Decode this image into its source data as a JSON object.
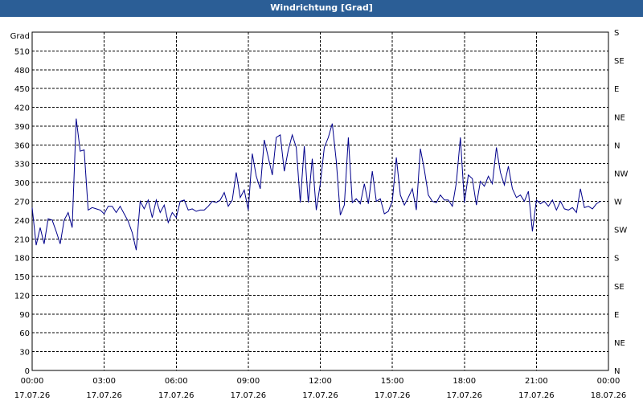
{
  "window": {
    "title": "Windrichtung [Grad]"
  },
  "colors": {
    "titlebar": "#2b5e96",
    "series": "#00008b",
    "grid": "#000000",
    "background": "#ffffff"
  },
  "chart_data": {
    "type": "line",
    "title": "Windrichtung [Grad]",
    "ylabel": "Grad",
    "xlabel": "",
    "ylim": [
      0,
      540
    ],
    "xlim": [
      "17.07.26 00:00",
      "18.07.26 00:00"
    ],
    "grid": true,
    "y_ticks": [
      0,
      30,
      60,
      90,
      120,
      150,
      180,
      210,
      240,
      270,
      300,
      330,
      360,
      390,
      420,
      450,
      480,
      510
    ],
    "x_ticks": [
      {
        "time": "00:00",
        "date": "17.07.26"
      },
      {
        "time": "03:00",
        "date": "17.07.26"
      },
      {
        "time": "06:00",
        "date": "17.07.26"
      },
      {
        "time": "09:00",
        "date": "17.07.26"
      },
      {
        "time": "12:00",
        "date": "17.07.26"
      },
      {
        "time": "15:00",
        "date": "17.07.26"
      },
      {
        "time": "18:00",
        "date": "17.07.26"
      },
      {
        "time": "21:00",
        "date": "17.07.26"
      },
      {
        "time": "00:00",
        "date": "18.07.26"
      }
    ],
    "right_axis": [
      {
        "label": "N",
        "value": 0
      },
      {
        "label": "NE",
        "value": 45
      },
      {
        "label": "E",
        "value": 90
      },
      {
        "label": "SE",
        "value": 135
      },
      {
        "label": "S",
        "value": 180
      },
      {
        "label": "SW",
        "value": 225
      },
      {
        "label": "W",
        "value": 270
      },
      {
        "label": "NW",
        "value": 315
      },
      {
        "label": "N",
        "value": 360
      },
      {
        "label": "NE",
        "value": 405
      },
      {
        "label": "E",
        "value": 450
      },
      {
        "label": "SE",
        "value": 495
      },
      {
        "label": "S",
        "value": 540
      }
    ],
    "series": [
      {
        "values": [
          [
            "17.07.26 00:00",
            260
          ],
          [
            "17.07.26 00:10",
            200
          ],
          [
            "17.07.26 00:20",
            228
          ],
          [
            "17.07.26 00:30",
            202
          ],
          [
            "17.07.26 00:40",
            242
          ],
          [
            "17.07.26 00:50",
            240
          ],
          [
            "17.07.26 01:00",
            222
          ],
          [
            "17.07.26 01:10",
            202
          ],
          [
            "17.07.26 01:20",
            240
          ],
          [
            "17.07.26 01:30",
            252
          ],
          [
            "17.07.26 01:40",
            228
          ],
          [
            "17.07.26 01:50",
            402
          ],
          [
            "17.07.26 02:00",
            350
          ],
          [
            "17.07.26 02:10",
            352
          ],
          [
            "17.07.26 02:20",
            256
          ],
          [
            "17.07.26 02:30",
            260
          ],
          [
            "17.07.26 02:40",
            258
          ],
          [
            "17.07.26 02:50",
            256
          ],
          [
            "17.07.26 03:00",
            250
          ],
          [
            "17.07.26 03:10",
            262
          ],
          [
            "17.07.26 03:20",
            262
          ],
          [
            "17.07.26 03:30",
            252
          ],
          [
            "17.07.26 03:40",
            262
          ],
          [
            "17.07.26 03:50",
            250
          ],
          [
            "17.07.26 04:00",
            238
          ],
          [
            "17.07.26 04:10",
            220
          ],
          [
            "17.07.26 04:20",
            192
          ],
          [
            "17.07.26 04:30",
            270
          ],
          [
            "17.07.26 04:40",
            258
          ],
          [
            "17.07.26 04:50",
            272
          ],
          [
            "17.07.26 05:00",
            244
          ],
          [
            "17.07.26 05:10",
            272
          ],
          [
            "17.07.26 05:20",
            252
          ],
          [
            "17.07.26 05:30",
            264
          ],
          [
            "17.07.26 05:40",
            236
          ],
          [
            "17.07.26 05:50",
            252
          ],
          [
            "17.07.26 06:00",
            244
          ],
          [
            "17.07.26 06:10",
            270
          ],
          [
            "17.07.26 06:20",
            272
          ],
          [
            "17.07.26 06:30",
            256
          ],
          [
            "17.07.26 06:40",
            258
          ],
          [
            "17.07.26 06:50",
            254
          ],
          [
            "17.07.26 07:00",
            256
          ],
          [
            "17.07.26 07:10",
            256
          ],
          [
            "17.07.26 07:20",
            262
          ],
          [
            "17.07.26 07:30",
            270
          ],
          [
            "17.07.26 07:40",
            268
          ],
          [
            "17.07.26 07:50",
            272
          ],
          [
            "17.07.26 08:00",
            284
          ],
          [
            "17.07.26 08:10",
            262
          ],
          [
            "17.07.26 08:20",
            272
          ],
          [
            "17.07.26 08:30",
            316
          ],
          [
            "17.07.26 08:40",
            276
          ],
          [
            "17.07.26 08:50",
            288
          ],
          [
            "17.07.26 09:00",
            256
          ],
          [
            "17.07.26 09:10",
            346
          ],
          [
            "17.07.26 09:20",
            310
          ],
          [
            "17.07.26 09:30",
            290
          ],
          [
            "17.07.26 09:40",
            368
          ],
          [
            "17.07.26 09:50",
            340
          ],
          [
            "17.07.26 10:00",
            312
          ],
          [
            "17.07.26 10:10",
            372
          ],
          [
            "17.07.26 10:20",
            376
          ],
          [
            "17.07.26 10:30",
            318
          ],
          [
            "17.07.26 10:40",
            352
          ],
          [
            "17.07.26 10:50",
            376
          ],
          [
            "17.07.26 11:00",
            356
          ],
          [
            "17.07.26 11:10",
            268
          ],
          [
            "17.07.26 11:20",
            358
          ],
          [
            "17.07.26 11:30",
            268
          ],
          [
            "17.07.26 11:40",
            338
          ],
          [
            "17.07.26 11:50",
            256
          ],
          [
            "17.07.26 12:00",
            298
          ],
          [
            "17.07.26 12:10",
            356
          ],
          [
            "17.07.26 12:20",
            372
          ],
          [
            "17.07.26 12:30",
            394
          ],
          [
            "17.07.26 12:40",
            334
          ],
          [
            "17.07.26 12:50",
            248
          ],
          [
            "17.07.26 13:00",
            264
          ],
          [
            "17.07.26 13:10",
            372
          ],
          [
            "17.07.26 13:20",
            268
          ],
          [
            "17.07.26 13:30",
            274
          ],
          [
            "17.07.26 13:40",
            266
          ],
          [
            "17.07.26 13:50",
            298
          ],
          [
            "17.07.26 14:00",
            266
          ],
          [
            "17.07.26 14:10",
            318
          ],
          [
            "17.07.26 14:20",
            270
          ],
          [
            "17.07.26 14:30",
            274
          ],
          [
            "17.07.26 14:40",
            250
          ],
          [
            "17.07.26 14:50",
            254
          ],
          [
            "17.07.26 15:00",
            270
          ],
          [
            "17.07.26 15:10",
            340
          ],
          [
            "17.07.26 15:20",
            280
          ],
          [
            "17.07.26 15:30",
            264
          ],
          [
            "17.07.26 15:40",
            276
          ],
          [
            "17.07.26 15:50",
            290
          ],
          [
            "17.07.26 16:00",
            256
          ],
          [
            "17.07.26 16:10",
            354
          ],
          [
            "17.07.26 16:20",
            320
          ],
          [
            "17.07.26 16:30",
            280
          ],
          [
            "17.07.26 16:40",
            270
          ],
          [
            "17.07.26 16:50",
            268
          ],
          [
            "17.07.26 17:00",
            280
          ],
          [
            "17.07.26 17:10",
            272
          ],
          [
            "17.07.26 17:20",
            272
          ],
          [
            "17.07.26 17:30",
            262
          ],
          [
            "17.07.26 17:40",
            300
          ],
          [
            "17.07.26 17:50",
            372
          ],
          [
            "17.07.26 18:00",
            268
          ],
          [
            "17.07.26 18:10",
            312
          ],
          [
            "17.07.26 18:20",
            306
          ],
          [
            "17.07.26 18:30",
            264
          ],
          [
            "17.07.26 18:40",
            302
          ],
          [
            "17.07.26 18:50",
            294
          ],
          [
            "17.07.26 19:00",
            310
          ],
          [
            "17.07.26 19:10",
            298
          ],
          [
            "17.07.26 19:20",
            356
          ],
          [
            "17.07.26 19:30",
            316
          ],
          [
            "17.07.26 19:40",
            296
          ],
          [
            "17.07.26 19:50",
            326
          ],
          [
            "17.07.26 20:00",
            290
          ],
          [
            "17.07.26 20:10",
            276
          ],
          [
            "17.07.26 20:20",
            280
          ],
          [
            "17.07.26 20:30",
            270
          ],
          [
            "17.07.26 20:40",
            286
          ],
          [
            "17.07.26 20:50",
            222
          ],
          [
            "17.07.26 21:00",
            272
          ],
          [
            "17.07.26 21:10",
            266
          ],
          [
            "17.07.26 21:20",
            270
          ],
          [
            "17.07.26 21:30",
            262
          ],
          [
            "17.07.26 21:40",
            272
          ],
          [
            "17.07.26 21:50",
            256
          ],
          [
            "17.07.26 22:00",
            270
          ],
          [
            "17.07.26 22:10",
            258
          ],
          [
            "17.07.26 22:20",
            256
          ],
          [
            "17.07.26 22:30",
            260
          ],
          [
            "17.07.26 22:40",
            252
          ],
          [
            "17.07.26 22:50",
            290
          ],
          [
            "17.07.26 23:00",
            260
          ],
          [
            "17.07.26 23:10",
            262
          ],
          [
            "17.07.26 23:20",
            258
          ],
          [
            "17.07.26 23:30",
            266
          ],
          [
            "17.07.26 23:40",
            270
          ]
        ]
      }
    ]
  }
}
